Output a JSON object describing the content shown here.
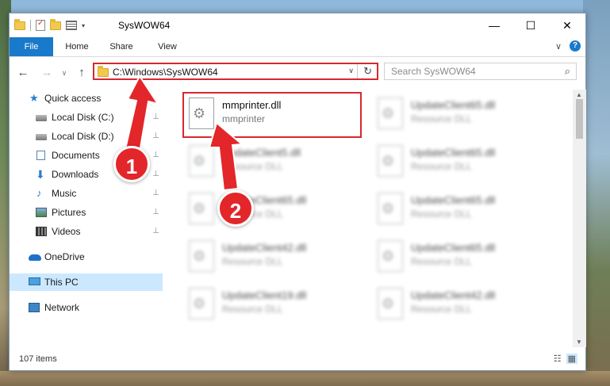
{
  "window": {
    "title": "SysWOW64",
    "controls": {
      "minimize": "—",
      "maximize": "☐",
      "close": "✕"
    }
  },
  "ribbon": {
    "tabs": [
      {
        "label": "File"
      },
      {
        "label": "Home"
      },
      {
        "label": "Share"
      },
      {
        "label": "View"
      }
    ],
    "expand_glyph": "∨",
    "help_glyph": "?"
  },
  "nav": {
    "back_glyph": "←",
    "forward_glyph": "→",
    "recent_glyph": "∨",
    "up_glyph": "↑",
    "address": "C:\\Windows\\SysWOW64",
    "address_dropdown": "∨",
    "refresh_glyph": "↻",
    "search_placeholder": "Search SysWOW64",
    "search_icon": "⌕"
  },
  "sidebar": {
    "items": [
      {
        "label": "Quick access",
        "icon": "star-icon",
        "pinned": false
      },
      {
        "label": "Local Disk (C:)",
        "icon": "disk-icon",
        "pinned": true
      },
      {
        "label": "Local Disk (D:)",
        "icon": "disk-icon",
        "pinned": true
      },
      {
        "label": "Documents",
        "icon": "documents-icon",
        "pinned": true
      },
      {
        "label": "Downloads",
        "icon": "download-icon",
        "pinned": true
      },
      {
        "label": "Music",
        "icon": "music-icon",
        "pinned": true
      },
      {
        "label": "Pictures",
        "icon": "pictures-icon",
        "pinned": true
      },
      {
        "label": "Videos",
        "icon": "videos-icon",
        "pinned": true
      },
      {
        "label": "OneDrive",
        "icon": "cloud-icon",
        "pinned": false
      },
      {
        "label": "This PC",
        "icon": "computer-icon",
        "pinned": false,
        "selected": true
      },
      {
        "label": "Network",
        "icon": "network-icon",
        "pinned": false
      }
    ],
    "pin_glyph": "📌"
  },
  "files": [
    {
      "name": "mmprinter.dll",
      "type": "mmprinter",
      "blurred": false
    },
    {
      "name": "UpdateClient65.dll",
      "type": "Resource DLL",
      "blurred": true
    },
    {
      "name": "UpdateClient5.dll",
      "type": "Resource DLL",
      "blurred": true
    },
    {
      "name": "UpdateClient65.dll",
      "type": "Resource DLL",
      "blurred": true
    },
    {
      "name": "UpdateClient65.dll",
      "type": "Resource DLL",
      "blurred": true
    },
    {
      "name": "UpdateClient65.dll",
      "type": "Resource DLL",
      "blurred": true
    },
    {
      "name": "UpdateClient42.dll",
      "type": "Resource DLL",
      "blurred": true
    },
    {
      "name": "UpdateClient65.dll",
      "type": "Resource DLL",
      "blurred": true
    },
    {
      "name": "UpdateClient19.dll",
      "type": "Resource DLL",
      "blurred": true
    },
    {
      "name": "UpdateClient42.dll",
      "type": "Resource DLL",
      "blurred": true
    }
  ],
  "status": {
    "item_count": "107 items",
    "details_view_glyph": "☷",
    "tiles_view_glyph": "▦"
  },
  "annotations": {
    "badge_1": "1",
    "badge_2": "2",
    "color": "#e2262a"
  }
}
